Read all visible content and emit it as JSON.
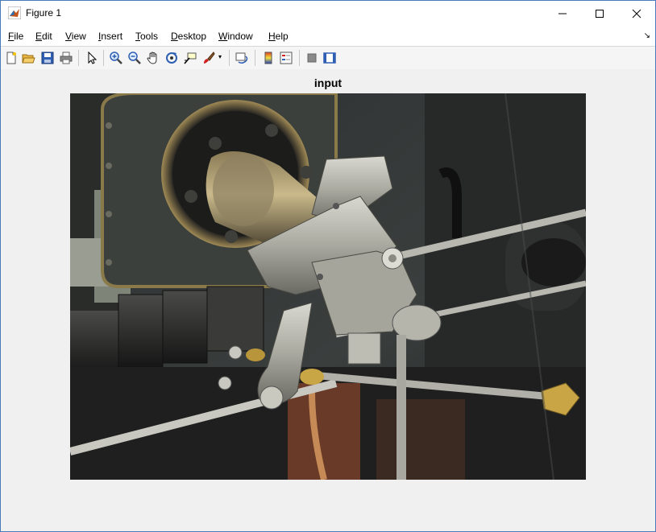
{
  "window": {
    "title": "Figure 1"
  },
  "menubar": {
    "items": [
      {
        "label": "File"
      },
      {
        "label": "Edit"
      },
      {
        "label": "View"
      },
      {
        "label": "Insert"
      },
      {
        "label": "Tools"
      },
      {
        "label": "Desktop"
      },
      {
        "label": "Window"
      },
      {
        "label": "Help"
      }
    ]
  },
  "toolbar": {
    "buttons": [
      "new-figure",
      "open-file",
      "save",
      "print",
      "edit-plot",
      "zoom-in",
      "zoom-out",
      "pan",
      "rotate-3d",
      "data-cursor",
      "brush",
      "link-plot",
      "colorbar",
      "legend",
      "hide-plot-tools",
      "show-plot-tools"
    ]
  },
  "axes": {
    "title": "input"
  },
  "colors": {
    "accent": "#4a7ab8",
    "figure_bg": "#f0f0f0"
  }
}
